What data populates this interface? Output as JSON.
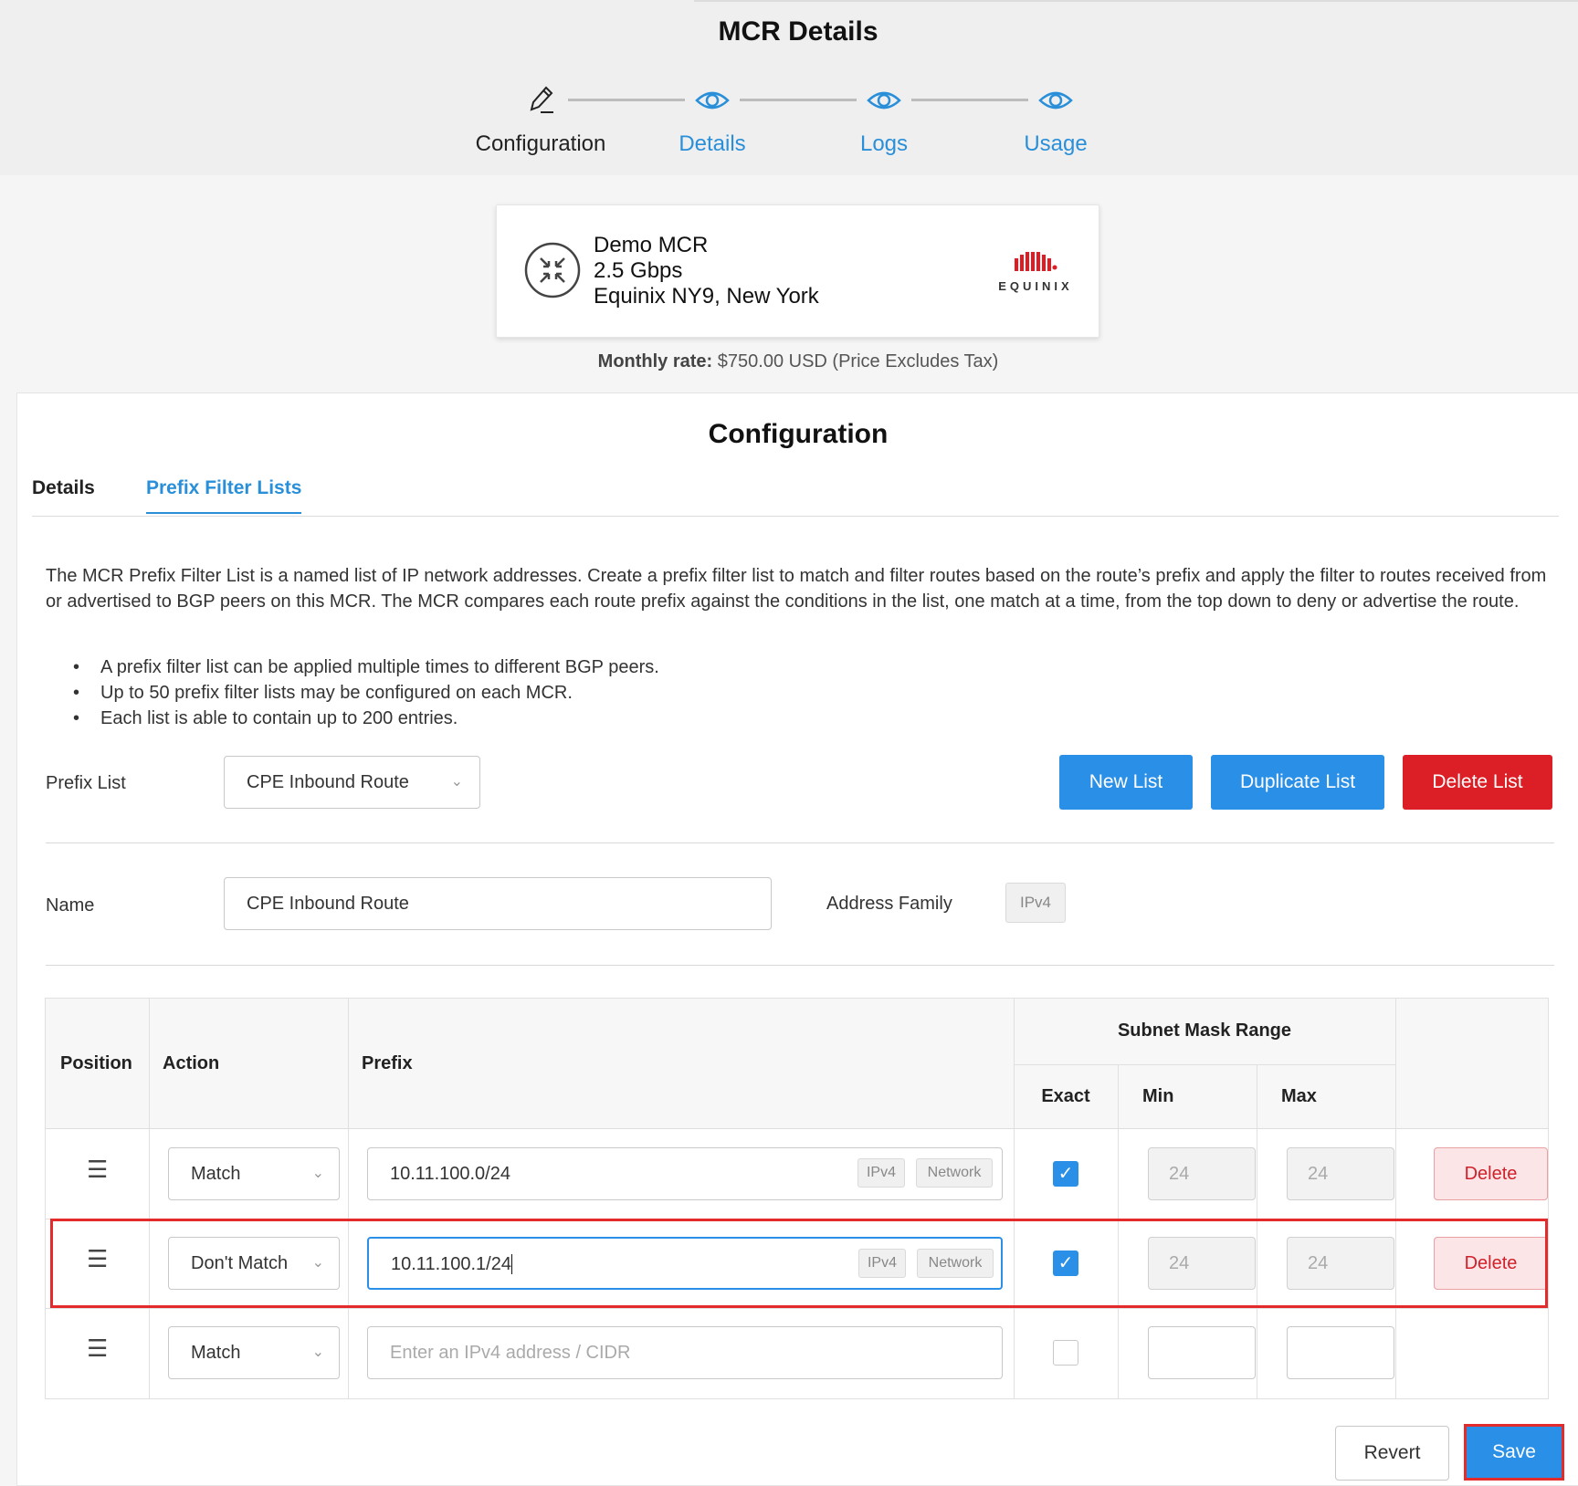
{
  "header": {
    "title": "MCR Details",
    "steps": [
      {
        "label": "Configuration",
        "icon": "pencil-icon",
        "active": true
      },
      {
        "label": "Details",
        "icon": "eye-icon"
      },
      {
        "label": "Logs",
        "icon": "eye-icon"
      },
      {
        "label": "Usage",
        "icon": "eye-icon"
      }
    ]
  },
  "product": {
    "name": "Demo MCR",
    "speed": "2.5 Gbps",
    "location": "Equinix NY9, New York",
    "provider_logo": "EQUINIX",
    "rate_label": "Monthly rate:",
    "rate_value": "$750.00 USD (Price Excludes Tax)"
  },
  "config": {
    "title": "Configuration",
    "tabs": [
      "Details",
      "Prefix Filter Lists"
    ],
    "description": "The MCR Prefix Filter List is a named list of IP network addresses. Create a prefix filter list to match and filter routes based on the route’s prefix and apply the filter to routes received from or advertised to BGP peers on this MCR. The MCR compares each route prefix against the conditions in the list, one match at a time, from the top down to deny or advertise the route.",
    "bullets": [
      "A prefix filter list can be applied multiple times to different BGP peers.",
      "Up to 50 prefix filter lists may be configured on each MCR.",
      "Each list is able to contain up to 200 entries."
    ],
    "prefix_list_label": "Prefix List",
    "prefix_list_value": "CPE Inbound Route",
    "buttons": {
      "new": "New List",
      "duplicate": "Duplicate List",
      "delete": "Delete List"
    },
    "name_label": "Name",
    "name_value": "CPE Inbound Route",
    "address_family_label": "Address Family",
    "address_family_value": "IPv4"
  },
  "table": {
    "headers": {
      "position": "Position",
      "action": "Action",
      "prefix": "Prefix",
      "subnet": "Subnet Mask Range",
      "exact": "Exact",
      "min": "Min",
      "max": "Max"
    },
    "rows": [
      {
        "action": "Match",
        "prefix": "10.11.100.0/24",
        "tag1": "IPv4",
        "tag2": "Network",
        "exact": true,
        "min": "24",
        "max": "24",
        "delete": "Delete"
      },
      {
        "action": "Don't Match",
        "prefix": "10.11.100.1/24",
        "tag1": "IPv4",
        "tag2": "Network",
        "exact": true,
        "min": "24",
        "max": "24",
        "delete": "Delete"
      },
      {
        "action": "Match",
        "prefix_placeholder": "Enter an IPv4 address / CIDR",
        "exact": false
      }
    ]
  },
  "footer": {
    "revert": "Revert",
    "save": "Save"
  },
  "colors": {
    "accent": "#2a8fe6",
    "danger": "#dc1f26",
    "highlight": "#e32b2b"
  }
}
